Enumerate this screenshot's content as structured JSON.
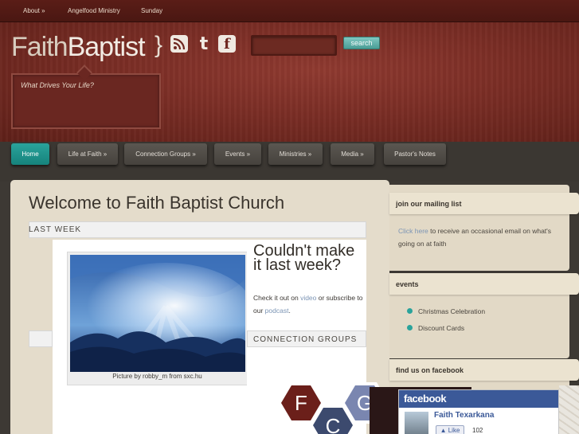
{
  "topbar": {
    "links": [
      "About »",
      "Angelfood Ministry",
      "Sunday"
    ]
  },
  "header": {
    "logo_light": "Faith",
    "logo_bold": "Baptist",
    "brace": "}",
    "search": {
      "placeholder": "",
      "button_label": "search"
    },
    "tagline": "What Drives Your Life?"
  },
  "nav": {
    "items": [
      {
        "label": "Home"
      },
      {
        "label": "Life at Faith »"
      },
      {
        "label": "Connection Groups »"
      },
      {
        "label": "Events »"
      },
      {
        "label": "Ministries »"
      },
      {
        "label": "Media »"
      },
      {
        "label": "Pastor's Notes"
      }
    ]
  },
  "main": {
    "title": "Welcome to Faith Baptist Church",
    "section_last_week": "LAST WEEK",
    "photo_caption": "Picture by robby_m from sxc.hu",
    "callout_title": "Couldn't make it last week?",
    "callout_text_1": "Check it out on ",
    "callout_link_video": "video",
    "callout_text_2": " or subscribe to our ",
    "callout_link_podcast": "podcast",
    "callout_text_3": ".",
    "section_connection": "CONNECTION GROUPS",
    "cg_letters": [
      "F",
      "C",
      "G"
    ]
  },
  "sidebar": {
    "mailing": {
      "title": "join our mailing list",
      "link": "Click here",
      "text": " to receive an occasional email on what's going on at faith"
    },
    "events": {
      "title": "events",
      "items": [
        "Christmas Celebration",
        "Discount Cards"
      ]
    },
    "facebook": {
      "title": "find us on facebook",
      "brand": "facebook",
      "page_name": "Faith Texarkana",
      "like_label": "Like",
      "like_count": "102"
    }
  },
  "colors": {
    "accent": "#2aa39b",
    "header_red": "#7a2d25",
    "content_bg": "#e4dccb",
    "facebook_blue": "#3b5998"
  },
  "icons": [
    "rss-icon",
    "twitter-icon",
    "facebook-icon",
    "like-thumb-icon",
    "event-bullet-icon"
  ]
}
